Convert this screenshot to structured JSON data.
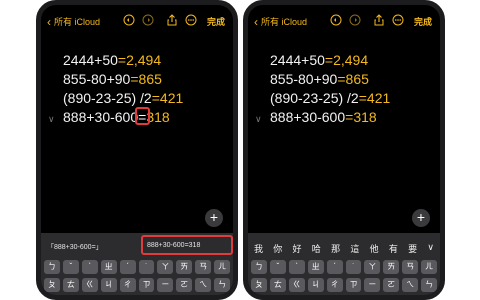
{
  "left": {
    "nav": {
      "back_label": "所有 iCloud",
      "done_label": "完成"
    },
    "lines": [
      {
        "expr": "2444+50",
        "eq": "=",
        "result": "2,494"
      },
      {
        "expr": "855-80+90",
        "eq": "=",
        "result": "865"
      },
      {
        "expr": "(890-23-25) /2",
        "eq": "=",
        "result": "421"
      },
      {
        "expr": "888+30-600",
        "eq": "=",
        "result": "318"
      }
    ],
    "candidates": [
      "「888+30-600=」",
      "888+30-600=318"
    ],
    "keys_row1": [
      "ㄅ",
      "ˇ",
      "ˋ",
      "ㄓ",
      "ˊ",
      "˙",
      "ㄚ",
      "ㄞ",
      "ㄢ",
      "ㄦ"
    ],
    "keys_row2": [
      "ㄆ",
      "ㄊ",
      "ㄍ",
      "ㄐ",
      "ㄔ",
      "ㄗ",
      "ㄧ",
      "ㄛ",
      "ㄟ",
      "ㄣ"
    ]
  },
  "right": {
    "nav": {
      "back_label": "所有 iCloud",
      "done_label": "完成"
    },
    "lines": [
      {
        "expr": "2444+50",
        "eq": "=",
        "result": "2,494"
      },
      {
        "expr": "855-80+90",
        "eq": "=",
        "result": "865"
      },
      {
        "expr": "(890-23-25) /2",
        "eq": "=",
        "result": "421"
      },
      {
        "expr": "888+30-600",
        "eq": "=",
        "result": "318"
      }
    ],
    "candidates": [
      "我",
      "你",
      "好",
      "哈",
      "那",
      "這",
      "他",
      "有",
      "要"
    ],
    "keys_row1": [
      "ㄅ",
      "ˇ",
      "ˋ",
      "ㄓ",
      "ˊ",
      "˙",
      "ㄚ",
      "ㄞ",
      "ㄢ",
      "ㄦ"
    ],
    "keys_row2": [
      "ㄆ",
      "ㄊ",
      "ㄍ",
      "ㄐ",
      "ㄔ",
      "ㄗ",
      "ㄧ",
      "ㄛ",
      "ㄟ",
      "ㄣ"
    ]
  },
  "colors": {
    "accent": "#f3b91e",
    "highlight": "#e23b3b",
    "background": "#000000"
  },
  "icons": [
    "chevron-left-icon",
    "undo-icon",
    "redo-icon",
    "share-icon",
    "more-icon",
    "plus-icon",
    "chevron-down-icon",
    "fold-chevron-icon"
  ]
}
